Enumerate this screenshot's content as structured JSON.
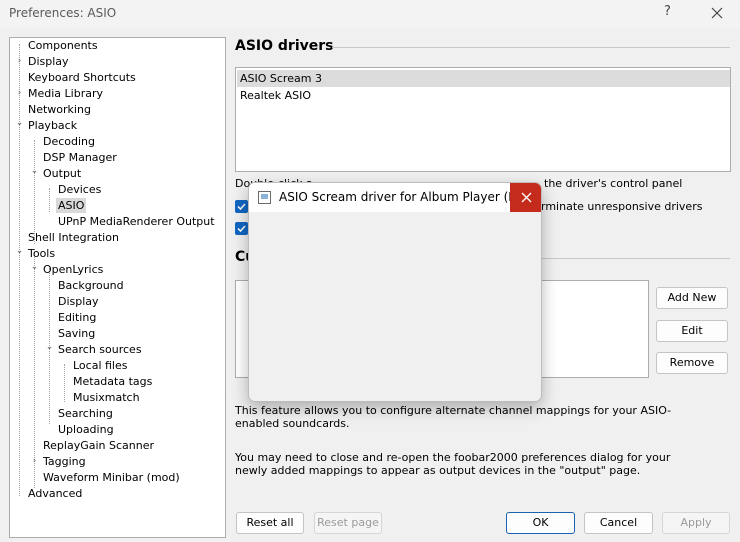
{
  "window": {
    "title": "Preferences: ASIO",
    "help_label": "?"
  },
  "tree": {
    "items": [
      {
        "label": "Components",
        "expander": ""
      },
      {
        "label": "Display",
        "expander": "›"
      },
      {
        "label": "Keyboard Shortcuts",
        "expander": ""
      },
      {
        "label": "Media Library",
        "expander": "›"
      },
      {
        "label": "Networking",
        "expander": ""
      },
      {
        "label": "Playback",
        "expander": "⌄"
      },
      {
        "label": "Decoding",
        "expander": ""
      },
      {
        "label": "DSP Manager",
        "expander": ""
      },
      {
        "label": "Output",
        "expander": "⌄"
      },
      {
        "label": "Devices",
        "expander": ""
      },
      {
        "label": "ASIO",
        "expander": "",
        "selected": true
      },
      {
        "label": "UPnP MediaRenderer Output",
        "expander": ""
      },
      {
        "label": "Shell Integration",
        "expander": ""
      },
      {
        "label": "Tools",
        "expander": "⌄"
      },
      {
        "label": "OpenLyrics",
        "expander": "⌄"
      },
      {
        "label": "Background",
        "expander": ""
      },
      {
        "label": "Display",
        "expander": ""
      },
      {
        "label": "Editing",
        "expander": ""
      },
      {
        "label": "Saving",
        "expander": ""
      },
      {
        "label": "Search sources",
        "expander": "⌄"
      },
      {
        "label": "Local files",
        "expander": ""
      },
      {
        "label": "Metadata tags",
        "expander": ""
      },
      {
        "label": "Musixmatch",
        "expander": ""
      },
      {
        "label": "Searching",
        "expander": ""
      },
      {
        "label": "Uploading",
        "expander": ""
      },
      {
        "label": "ReplayGain Scanner",
        "expander": ""
      },
      {
        "label": "Tagging",
        "expander": "›"
      },
      {
        "label": "Waveform Minibar (mod)",
        "expander": ""
      },
      {
        "label": "Advanced",
        "expander": ""
      }
    ]
  },
  "asio": {
    "section_title": "ASIO drivers",
    "drivers": [
      "ASIO Scream 3",
      "Realtek ASIO"
    ],
    "hint_visible": "Double-click a",
    "hint_visible_tail": "the driver's control panel",
    "checkbox1_label_tail": "rminate unresponsive drivers",
    "custom_section_title_partial": "Cu"
  },
  "buttons": {
    "add_new": "Add New",
    "edit": "Edit",
    "remove": "Remove",
    "reset_all": "Reset all",
    "reset_page": "Reset page",
    "ok": "OK",
    "cancel": "Cancel",
    "apply": "Apply"
  },
  "text": {
    "para1": "This feature allows you to configure alternate channel mappings for your ASIO-enabled soundcards.",
    "para2": "You may need to close and re-open the foobar2000 preferences dialog for your newly added mappings to appear as output devices in the \"output\" page."
  },
  "modal": {
    "title": "ASIO Scream driver for Album Player (He..."
  },
  "colors": {
    "accent": "#1167c2",
    "close_red": "#c42b1c"
  }
}
